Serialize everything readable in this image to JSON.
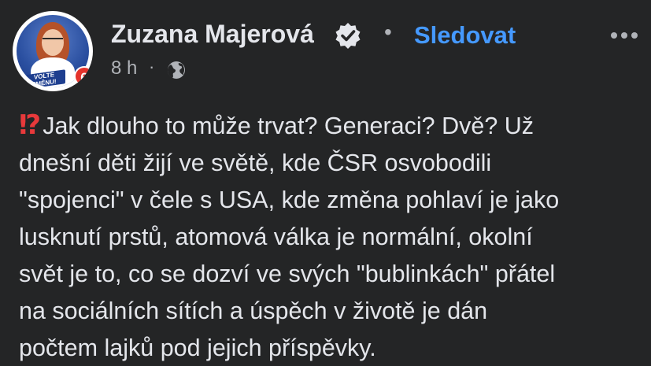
{
  "post": {
    "author": "Zuzana Majerová",
    "follow_label": "Sledovat",
    "separator": "•",
    "time": "8 h",
    "time_separator": "·",
    "privacy_icon": "globe-icon",
    "avatar": {
      "banner_line1": "VOLTE",
      "banner_line2": "ZMĚNU!",
      "badge_number": "6"
    },
    "emoji": "⁉",
    "lines": [
      "Jak dlouho to může trvat? Generaci? Dvě? Už",
      "dnešní děti žijí ve světě, kde ČSR osvobodili",
      "\"spojenci\" v čele s USA, kde změna pohlaví je jako",
      "lusknutí prstů, atomová válka je normální, okolní",
      "svět je to, co se dozví ve svých \"bublinkách\" přátel",
      "na sociálních sítích a úspěch v životě je dán",
      "počtem lajků pod jejich příspěvky."
    ]
  },
  "colors": {
    "background": "#242526",
    "text": "#e4e6eb",
    "secondary": "#b0b3b8",
    "link": "#4599ff",
    "emoji_red": "#e8393b"
  }
}
